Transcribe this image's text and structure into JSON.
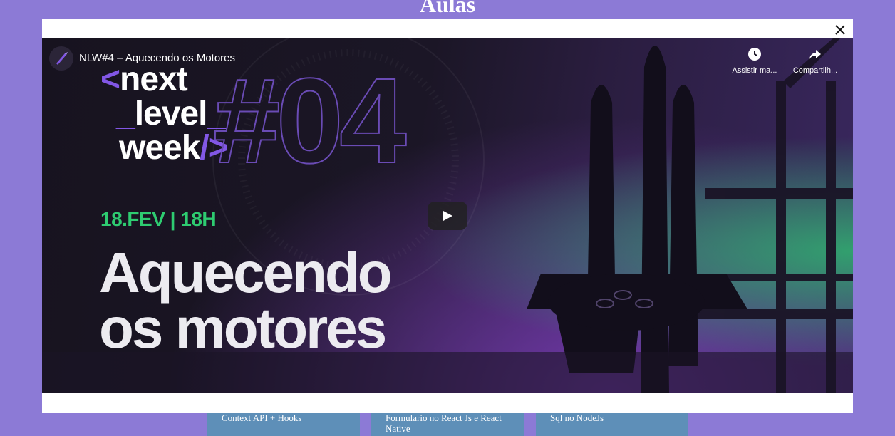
{
  "page": {
    "heading": "Aulas"
  },
  "cards": [
    {
      "title": "Context API + Hooks"
    },
    {
      "title": "Formulario no React Js e React Native"
    },
    {
      "title": "Sql no NodeJs"
    }
  ],
  "video": {
    "title": "NLW#4 – Aquecendo os Motores",
    "watch_later_label": "Assistir ma...",
    "share_label": "Compartilh...",
    "thumbnail": {
      "logo_line1_prefix": "<",
      "logo_line1": "next",
      "logo_line2_prefix": "_",
      "logo_line2": "level",
      "logo_line2_suffix": "_",
      "logo_line3": "week",
      "logo_line3_suffix": "/>",
      "edition": "#04",
      "date": "18.FEV | 18H",
      "headline_line1": "Aquecendo",
      "headline_line2": "os motores"
    }
  },
  "icons": {
    "close": "close-icon",
    "play": "play-icon",
    "watch_later": "clock-icon",
    "share": "share-icon",
    "channel": "rocket-icon"
  },
  "colors": {
    "background": "#8c7ad6",
    "card": "#5e8fb8",
    "accent_purple": "#8257e5",
    "accent_green": "#2ecc71"
  }
}
